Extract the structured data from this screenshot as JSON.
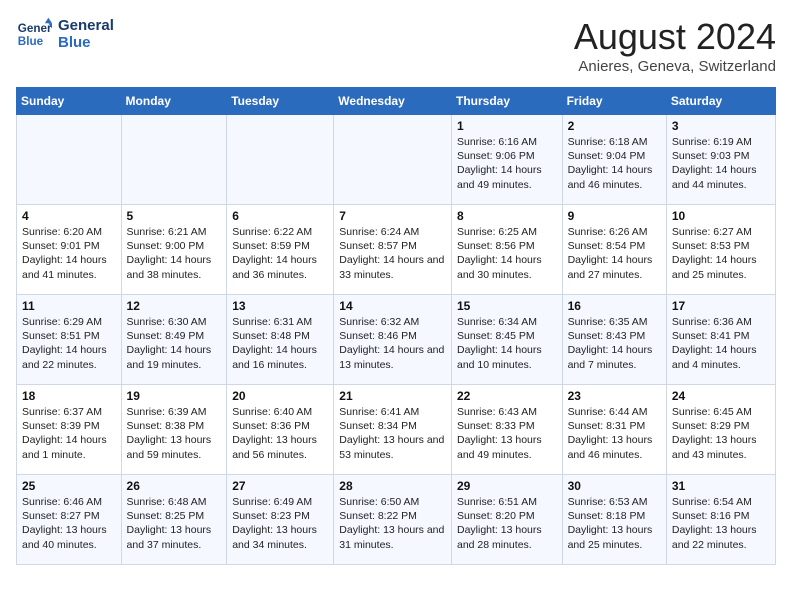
{
  "header": {
    "logo_line1": "General",
    "logo_line2": "Blue",
    "main_title": "August 2024",
    "subtitle": "Anieres, Geneva, Switzerland"
  },
  "days_of_week": [
    "Sunday",
    "Monday",
    "Tuesday",
    "Wednesday",
    "Thursday",
    "Friday",
    "Saturday"
  ],
  "weeks": [
    [
      {
        "day": "",
        "info": ""
      },
      {
        "day": "",
        "info": ""
      },
      {
        "day": "",
        "info": ""
      },
      {
        "day": "",
        "info": ""
      },
      {
        "day": "1",
        "info": "Sunrise: 6:16 AM\nSunset: 9:06 PM\nDaylight: 14 hours and 49 minutes."
      },
      {
        "day": "2",
        "info": "Sunrise: 6:18 AM\nSunset: 9:04 PM\nDaylight: 14 hours and 46 minutes."
      },
      {
        "day": "3",
        "info": "Sunrise: 6:19 AM\nSunset: 9:03 PM\nDaylight: 14 hours and 44 minutes."
      }
    ],
    [
      {
        "day": "4",
        "info": "Sunrise: 6:20 AM\nSunset: 9:01 PM\nDaylight: 14 hours and 41 minutes."
      },
      {
        "day": "5",
        "info": "Sunrise: 6:21 AM\nSunset: 9:00 PM\nDaylight: 14 hours and 38 minutes."
      },
      {
        "day": "6",
        "info": "Sunrise: 6:22 AM\nSunset: 8:59 PM\nDaylight: 14 hours and 36 minutes."
      },
      {
        "day": "7",
        "info": "Sunrise: 6:24 AM\nSunset: 8:57 PM\nDaylight: 14 hours and 33 minutes."
      },
      {
        "day": "8",
        "info": "Sunrise: 6:25 AM\nSunset: 8:56 PM\nDaylight: 14 hours and 30 minutes."
      },
      {
        "day": "9",
        "info": "Sunrise: 6:26 AM\nSunset: 8:54 PM\nDaylight: 14 hours and 27 minutes."
      },
      {
        "day": "10",
        "info": "Sunrise: 6:27 AM\nSunset: 8:53 PM\nDaylight: 14 hours and 25 minutes."
      }
    ],
    [
      {
        "day": "11",
        "info": "Sunrise: 6:29 AM\nSunset: 8:51 PM\nDaylight: 14 hours and 22 minutes."
      },
      {
        "day": "12",
        "info": "Sunrise: 6:30 AM\nSunset: 8:49 PM\nDaylight: 14 hours and 19 minutes."
      },
      {
        "day": "13",
        "info": "Sunrise: 6:31 AM\nSunset: 8:48 PM\nDaylight: 14 hours and 16 minutes."
      },
      {
        "day": "14",
        "info": "Sunrise: 6:32 AM\nSunset: 8:46 PM\nDaylight: 14 hours and 13 minutes."
      },
      {
        "day": "15",
        "info": "Sunrise: 6:34 AM\nSunset: 8:45 PM\nDaylight: 14 hours and 10 minutes."
      },
      {
        "day": "16",
        "info": "Sunrise: 6:35 AM\nSunset: 8:43 PM\nDaylight: 14 hours and 7 minutes."
      },
      {
        "day": "17",
        "info": "Sunrise: 6:36 AM\nSunset: 8:41 PM\nDaylight: 14 hours and 4 minutes."
      }
    ],
    [
      {
        "day": "18",
        "info": "Sunrise: 6:37 AM\nSunset: 8:39 PM\nDaylight: 14 hours and 1 minute."
      },
      {
        "day": "19",
        "info": "Sunrise: 6:39 AM\nSunset: 8:38 PM\nDaylight: 13 hours and 59 minutes."
      },
      {
        "day": "20",
        "info": "Sunrise: 6:40 AM\nSunset: 8:36 PM\nDaylight: 13 hours and 56 minutes."
      },
      {
        "day": "21",
        "info": "Sunrise: 6:41 AM\nSunset: 8:34 PM\nDaylight: 13 hours and 53 minutes."
      },
      {
        "day": "22",
        "info": "Sunrise: 6:43 AM\nSunset: 8:33 PM\nDaylight: 13 hours and 49 minutes."
      },
      {
        "day": "23",
        "info": "Sunrise: 6:44 AM\nSunset: 8:31 PM\nDaylight: 13 hours and 46 minutes."
      },
      {
        "day": "24",
        "info": "Sunrise: 6:45 AM\nSunset: 8:29 PM\nDaylight: 13 hours and 43 minutes."
      }
    ],
    [
      {
        "day": "25",
        "info": "Sunrise: 6:46 AM\nSunset: 8:27 PM\nDaylight: 13 hours and 40 minutes."
      },
      {
        "day": "26",
        "info": "Sunrise: 6:48 AM\nSunset: 8:25 PM\nDaylight: 13 hours and 37 minutes."
      },
      {
        "day": "27",
        "info": "Sunrise: 6:49 AM\nSunset: 8:23 PM\nDaylight: 13 hours and 34 minutes."
      },
      {
        "day": "28",
        "info": "Sunrise: 6:50 AM\nSunset: 8:22 PM\nDaylight: 13 hours and 31 minutes."
      },
      {
        "day": "29",
        "info": "Sunrise: 6:51 AM\nSunset: 8:20 PM\nDaylight: 13 hours and 28 minutes."
      },
      {
        "day": "30",
        "info": "Sunrise: 6:53 AM\nSunset: 8:18 PM\nDaylight: 13 hours and 25 minutes."
      },
      {
        "day": "31",
        "info": "Sunrise: 6:54 AM\nSunset: 8:16 PM\nDaylight: 13 hours and 22 minutes."
      }
    ]
  ]
}
